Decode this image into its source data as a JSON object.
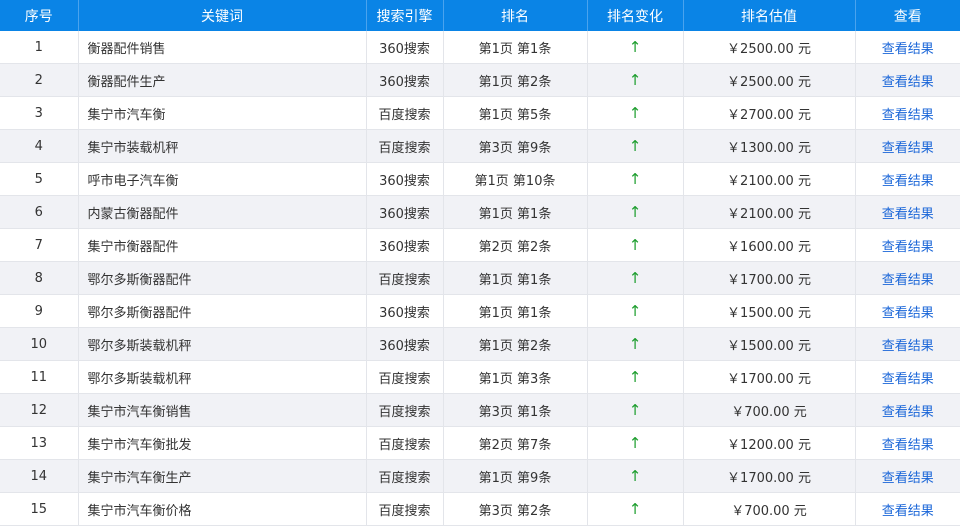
{
  "accent_color": "#0a84e6",
  "up_color": "#1e9e2f",
  "link_color": "#1a66d8",
  "headers": {
    "index": "序号",
    "keyword": "关键词",
    "engine": "搜索引擎",
    "rank": "排名",
    "change": "排名变化",
    "value": "排名估值",
    "view": "查看"
  },
  "rows": [
    {
      "index": "1",
      "keyword": "衡器配件销售",
      "engine": "360搜索",
      "rank": "第1页 第1条",
      "change": "↑",
      "value": "￥2500.00 元",
      "view": "查看结果"
    },
    {
      "index": "2",
      "keyword": "衡器配件生产",
      "engine": "360搜索",
      "rank": "第1页 第2条",
      "change": "↑",
      "value": "￥2500.00 元",
      "view": "查看结果"
    },
    {
      "index": "3",
      "keyword": "集宁市汽车衡",
      "engine": "百度搜索",
      "rank": "第1页 第5条",
      "change": "↑",
      "value": "￥2700.00 元",
      "view": "查看结果"
    },
    {
      "index": "4",
      "keyword": "集宁市装载机秤",
      "engine": "百度搜索",
      "rank": "第3页 第9条",
      "change": "↑",
      "value": "￥1300.00 元",
      "view": "查看结果"
    },
    {
      "index": "5",
      "keyword": "呼市电子汽车衡",
      "engine": "360搜索",
      "rank": "第1页 第10条",
      "change": "↑",
      "value": "￥2100.00 元",
      "view": "查看结果"
    },
    {
      "index": "6",
      "keyword": "内蒙古衡器配件",
      "engine": "360搜索",
      "rank": "第1页 第1条",
      "change": "↑",
      "value": "￥2100.00 元",
      "view": "查看结果"
    },
    {
      "index": "7",
      "keyword": "集宁市衡器配件",
      "engine": "360搜索",
      "rank": "第2页 第2条",
      "change": "↑",
      "value": "￥1600.00 元",
      "view": "查看结果"
    },
    {
      "index": "8",
      "keyword": "鄂尔多斯衡器配件",
      "engine": "百度搜索",
      "rank": "第1页 第1条",
      "change": "↑",
      "value": "￥1700.00 元",
      "view": "查看结果"
    },
    {
      "index": "9",
      "keyword": "鄂尔多斯衡器配件",
      "engine": "360搜索",
      "rank": "第1页 第1条",
      "change": "↑",
      "value": "￥1500.00 元",
      "view": "查看结果"
    },
    {
      "index": "10",
      "keyword": "鄂尔多斯装载机秤",
      "engine": "360搜索",
      "rank": "第1页 第2条",
      "change": "↑",
      "value": "￥1500.00 元",
      "view": "查看结果"
    },
    {
      "index": "11",
      "keyword": "鄂尔多斯装载机秤",
      "engine": "百度搜索",
      "rank": "第1页 第3条",
      "change": "↑",
      "value": "￥1700.00 元",
      "view": "查看结果"
    },
    {
      "index": "12",
      "keyword": "集宁市汽车衡销售",
      "engine": "百度搜索",
      "rank": "第3页 第1条",
      "change": "↑",
      "value": "￥700.00 元",
      "view": "查看结果"
    },
    {
      "index": "13",
      "keyword": "集宁市汽车衡批发",
      "engine": "百度搜索",
      "rank": "第2页 第7条",
      "change": "↑",
      "value": "￥1200.00 元",
      "view": "查看结果"
    },
    {
      "index": "14",
      "keyword": "集宁市汽车衡生产",
      "engine": "百度搜索",
      "rank": "第1页 第9条",
      "change": "↑",
      "value": "￥1700.00 元",
      "view": "查看结果"
    },
    {
      "index": "15",
      "keyword": "集宁市汽车衡价格",
      "engine": "百度搜索",
      "rank": "第3页 第2条",
      "change": "↑",
      "value": "￥700.00 元",
      "view": "查看结果"
    }
  ]
}
